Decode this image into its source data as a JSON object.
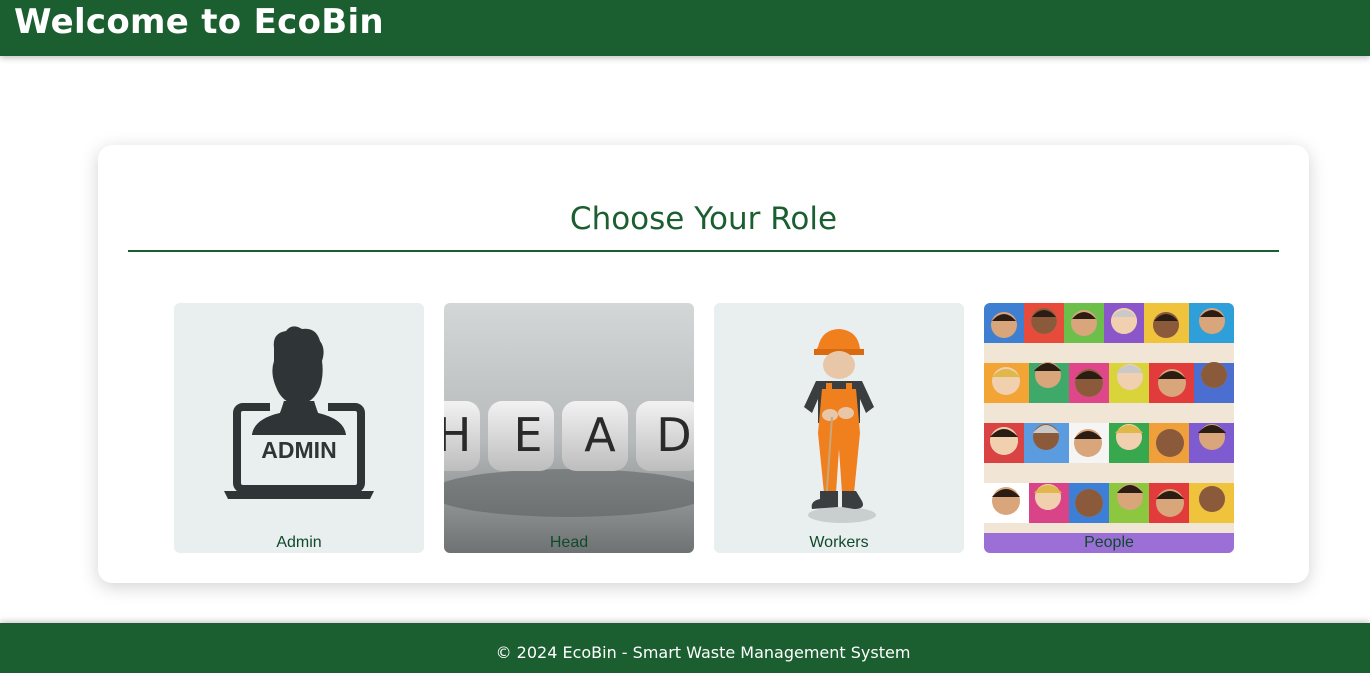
{
  "header": {
    "title": "Welcome to EcoBin"
  },
  "card": {
    "title": "Choose Your Role"
  },
  "roles": [
    {
      "label": "Admin",
      "image_text": "ADMIN",
      "icon": "admin-laptop-icon"
    },
    {
      "label": "Head",
      "image_text": "HEAD",
      "icon": "letter-blocks-image"
    },
    {
      "label": "Workers",
      "icon": "construction-worker-image"
    },
    {
      "label": "People",
      "icon": "crowd-image"
    }
  ],
  "footer": {
    "text": "© 2024 EcoBin - Smart Waste Management System"
  },
  "colors": {
    "brand_green": "#1b5e30",
    "label_green": "#0f4a2c",
    "card_tile_bg": "#e9eeee"
  }
}
